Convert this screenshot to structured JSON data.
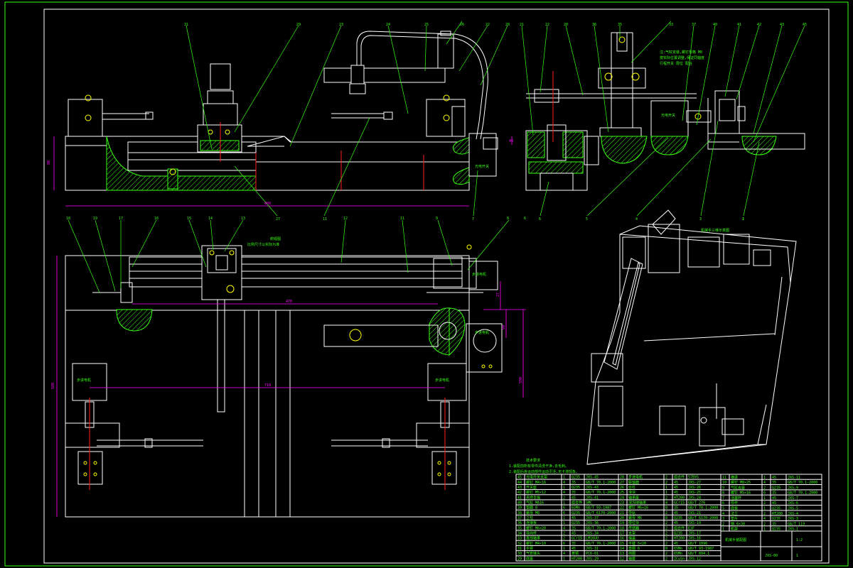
{
  "drawing": {
    "notes_title": "技术要求",
    "notes_lines": [
      "1.装配前所有零件清洗干净,去毛刺。",
      "2.装配后各运动部件运动灵活,无卡滞现象。"
    ],
    "sensor_labels": [
      "光电开关",
      "光电开关",
      "步进电机",
      "步进电机",
      "步进电机",
      "步进电机"
    ],
    "view_label_top": "机械手侧视图",
    "view_label_plan": "俯视图",
    "view_label_plan_note": "比例尺寸以实际为准",
    "iso_label": "机械手三维示意图",
    "detail_note": [
      "注:气缸安装,螺钉规格 M8",
      "按实际位置调整,保证同轴度",
      "行程开关 限位 配合"
    ],
    "balloons_top": [
      "31",
      "29",
      "23",
      "24",
      "25",
      "26",
      "22",
      "28",
      "21",
      "22",
      "20",
      "36",
      "35",
      "33",
      "37",
      "40",
      "41",
      "42",
      "43",
      "45"
    ],
    "balloons_bottom": [
      "7",
      "27",
      "11",
      "6",
      "5",
      "4",
      "3",
      "2",
      "1"
    ],
    "balloons_plan": [
      "18",
      "19",
      "17",
      "16",
      "15",
      "14",
      "13",
      "12",
      "11",
      "9",
      "8",
      "6"
    ],
    "dimensions": {
      "top_length": "800",
      "top_height": "80",
      "plan_height": "580",
      "plan_len_a": "470",
      "plan_len_b": "710",
      "plan_len_c": "590",
      "right_h1": "60",
      "right_h2": "27",
      "right_h3": "40"
    }
  },
  "title_block": {
    "title": "机械手装配图",
    "drawing_no": "JXS-00",
    "scale": "1:2",
    "sheet": "1",
    "rows": [
      [
        "45",
        "光电开关支架",
        "1",
        "Q235",
        "JXS-45"
      ],
      [
        "44",
        "螺钉 M4×16",
        "4",
        "35",
        "GB/T 70.1-2000"
      ],
      [
        "43",
        "开关座",
        "1",
        "Q235",
        "JXS-43"
      ],
      [
        "42",
        "螺钉 M5×12",
        "4",
        "35",
        "GB/T 70.1-2000"
      ],
      [
        "41",
        "夹持手指",
        "2",
        "45",
        "JXS-41"
      ],
      [
        "40",
        "气缸 MA16",
        "1",
        "组合件",
        "SMC"
      ],
      [
        "39",
        "垫圈 8",
        "6",
        "65Mn",
        "GB/T 93-1987"
      ],
      [
        "38",
        "螺母 M8",
        "6",
        "Q235",
        "GB/T 6170-2000"
      ],
      [
        "37",
        "立柱",
        "1",
        "45",
        "JXS-37"
      ],
      [
        "36",
        "连接板",
        "1",
        "Q235",
        "JXS-36"
      ],
      [
        "35",
        "螺钉 M6×20",
        "4",
        "35",
        "GB/T 70.1-2000"
      ],
      [
        "34",
        "导向杆",
        "2",
        "45",
        "JXS-34"
      ],
      [
        "33",
        "直线轴承",
        "2",
        "GCr15",
        "LM16UU"
      ],
      [
        "32",
        "螺钉 M4×10",
        "6",
        "35",
        "GB/T 70.1-2000"
      ],
      [
        "31",
        "手臂",
        "1",
        "45",
        "JXS-31"
      ],
      [
        "30",
        "气管接头",
        "4",
        "黄铜",
        "PC6-01"
      ],
      [
        "29",
        "底座",
        "1",
        "HT200",
        "JXS-29"
      ]
    ],
    "rows_mid": [
      [
        "28",
        "步进电机",
        "2",
        "组合件",
        "57BYG"
      ],
      [
        "27",
        "联轴器",
        "2",
        "45",
        "JXS-27"
      ],
      [
        "26",
        "丝杠",
        "1",
        "45",
        "JXS-26"
      ],
      [
        "25",
        "滑块",
        "1",
        "45",
        "JXS-25"
      ],
      [
        "24",
        "轴承座",
        "2",
        "HT200",
        "JXS-24"
      ],
      [
        "23",
        "深沟球轴承",
        "4",
        "GCr15",
        "GB/T 276"
      ],
      [
        "22",
        "螺钉 M6×16",
        "8",
        "35",
        "GB/T 70.1-2000"
      ],
      [
        "21",
        "导轨",
        "2",
        "45",
        "JXS-21"
      ],
      [
        "20",
        "螺母 M6",
        "8",
        "Q235",
        "GB/T 6170-2000"
      ],
      [
        "19",
        "限位块",
        "2",
        "45",
        "JXS-19"
      ],
      [
        "18",
        "传感器",
        "2",
        "组合件",
        "E3F"
      ],
      [
        "17",
        "支架",
        "2",
        "Q235",
        "JXS-17"
      ],
      [
        "16",
        "端盖",
        "2",
        "HT200",
        "JXS-16"
      ],
      [
        "15",
        "平键 5×20",
        "2",
        "45",
        "GB/T 1096"
      ],
      [
        "14",
        "垫圈 6",
        "8",
        "65Mn",
        "GB/T 93-1987"
      ],
      [
        "13",
        "挡圈",
        "2",
        "65Mn",
        "GB/T 894.1"
      ],
      [
        "12",
        "轴套",
        "2",
        "ZCuSn",
        "JXS-12"
      ]
    ],
    "rows_right": [
      [
        "11",
        "横梁",
        "1",
        "45",
        "JXS-11"
      ],
      [
        "10",
        "螺钉 M8×25",
        "4",
        "35",
        "GB/T 70.1-2000"
      ],
      [
        "9",
        "气缸支座",
        "2",
        "Q235",
        "JXS-9"
      ],
      [
        "8",
        "螺钉 M5×16",
        "6",
        "35",
        "GB/T 70.1-2000"
      ],
      [
        "7",
        "活塞杆",
        "1",
        "45",
        "JXS-7"
      ],
      [
        "6",
        "导杆",
        "2",
        "45",
        "JXS-6"
      ],
      [
        "5",
        "底板",
        "1",
        "Q235",
        "JXS-5"
      ],
      [
        "4",
        "法兰",
        "2",
        "HT200",
        "JXS-4"
      ],
      [
        "3",
        "垫片",
        "4",
        "Q235",
        "JXS-3"
      ],
      [
        "2",
        "销 6×30",
        "2",
        "35",
        "GB/T 119"
      ],
      [
        "1",
        "机架",
        "1",
        "Q235",
        "JXS-1"
      ]
    ]
  }
}
